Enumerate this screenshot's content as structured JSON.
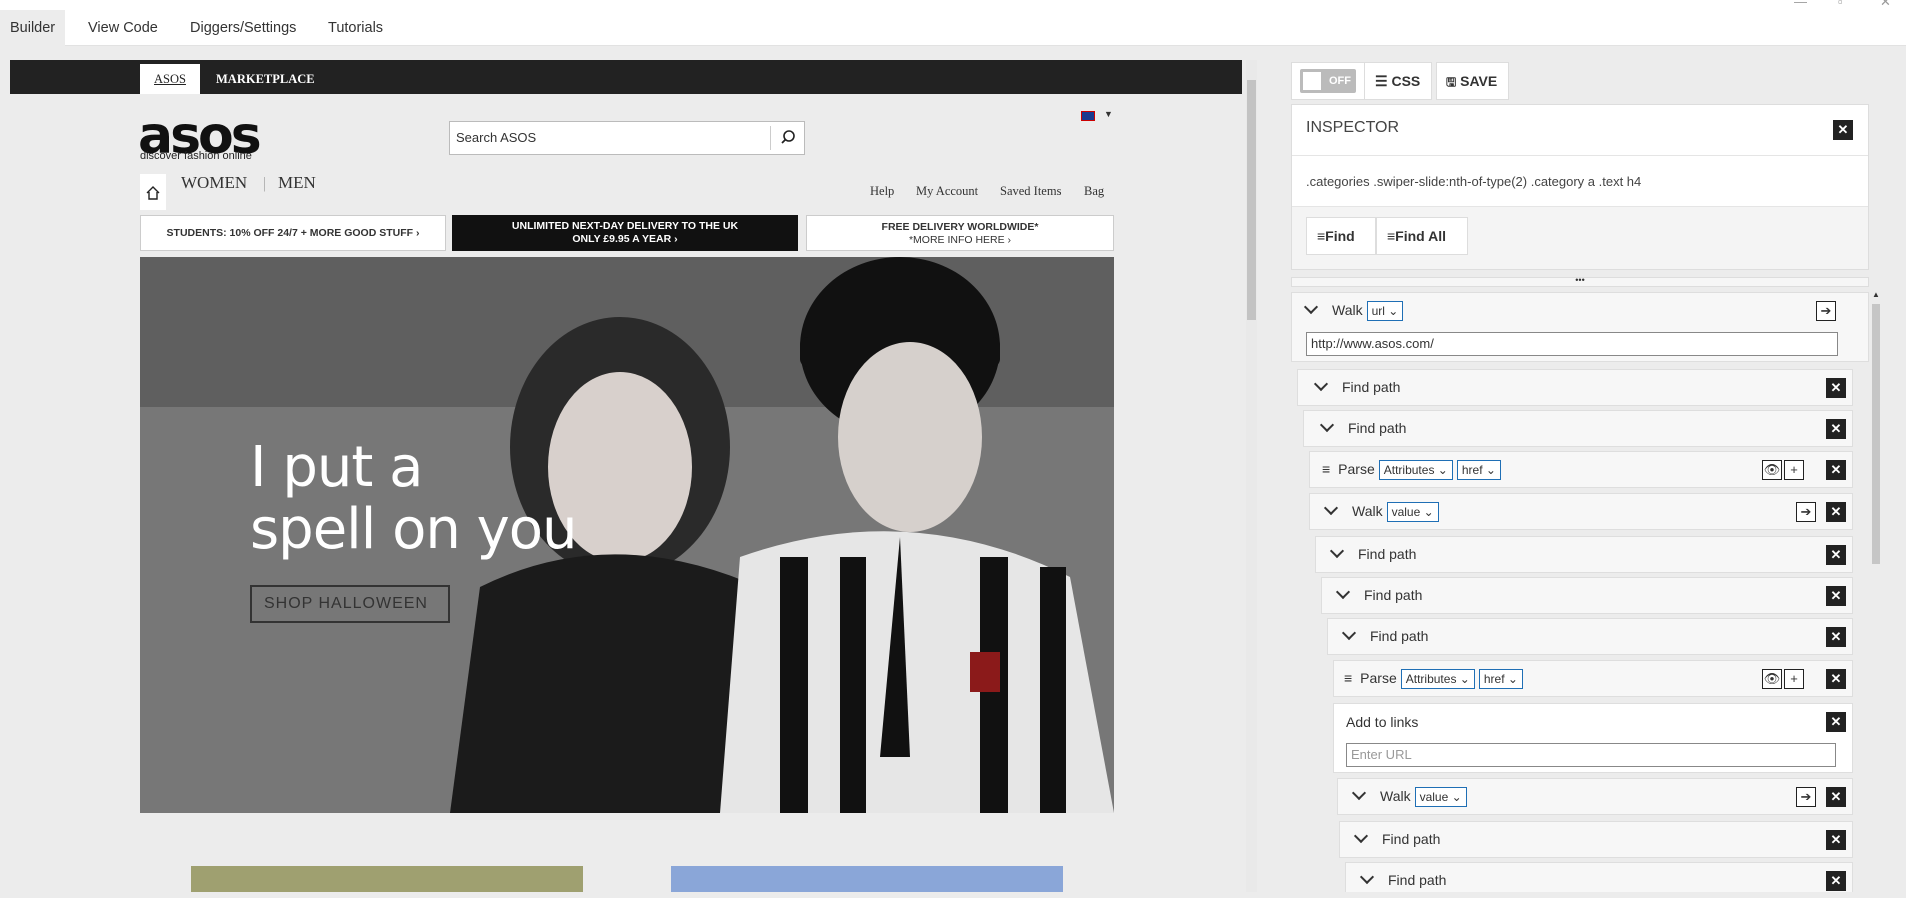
{
  "tabs": [
    {
      "label": "Builder"
    },
    {
      "label": "View Code"
    },
    {
      "label": "Diggers/Settings"
    },
    {
      "label": "Tutorials"
    }
  ],
  "asos": {
    "tabs": [
      "ASOS",
      "MARKETPLACE"
    ],
    "logo": "asos",
    "tagline": "discover fashion online",
    "search_placeholder": "Search ASOS",
    "gender_nav": [
      "WOMEN",
      "MEN"
    ],
    "utility_nav": [
      "Help",
      "My Account",
      "Saved Items",
      "Bag"
    ],
    "promos": [
      {
        "line1": "STUDENTS: 10% OFF 24/7 + MORE GOOD STUFF ›",
        "line2": ""
      },
      {
        "line1": "UNLIMITED NEXT-DAY DELIVERY TO THE UK",
        "line2": "ONLY £9.95 A YEAR ›"
      },
      {
        "line1": "FREE DELIVERY WORLDWIDE*",
        "line2": "*MORE INFO HERE ›"
      }
    ],
    "hero_line1": "I put a",
    "hero_line2": "spell on you",
    "hero_button": "SHOP HALLOWEEN"
  },
  "toolbar": {
    "toggle": "OFF",
    "css": "CSS",
    "save": "SAVE"
  },
  "inspector": {
    "title": "INSPECTOR",
    "selector": ".categories .swiper-slide:nth-of-type(2) .category a .text h4",
    "find": "Find",
    "find_all": "Find All"
  },
  "steps": {
    "walk1": {
      "label": "Walk",
      "select": "url",
      "url": "http://www.asos.com/"
    },
    "find1": "Find path",
    "find2": "Find path",
    "parse1": {
      "label": "Parse",
      "sel1": "Attributes",
      "sel2": "href"
    },
    "walk2": {
      "label": "Walk",
      "select": "value"
    },
    "find3": "Find path",
    "find4": "Find path",
    "find5": "Find path",
    "parse2": {
      "label": "Parse",
      "sel1": "Attributes",
      "sel2": "href"
    },
    "addlinks": {
      "label": "Add to links",
      "placeholder": "Enter URL"
    },
    "walk3": {
      "label": "Walk",
      "select": "value"
    },
    "find6": "Find path",
    "find7": "Find path"
  }
}
